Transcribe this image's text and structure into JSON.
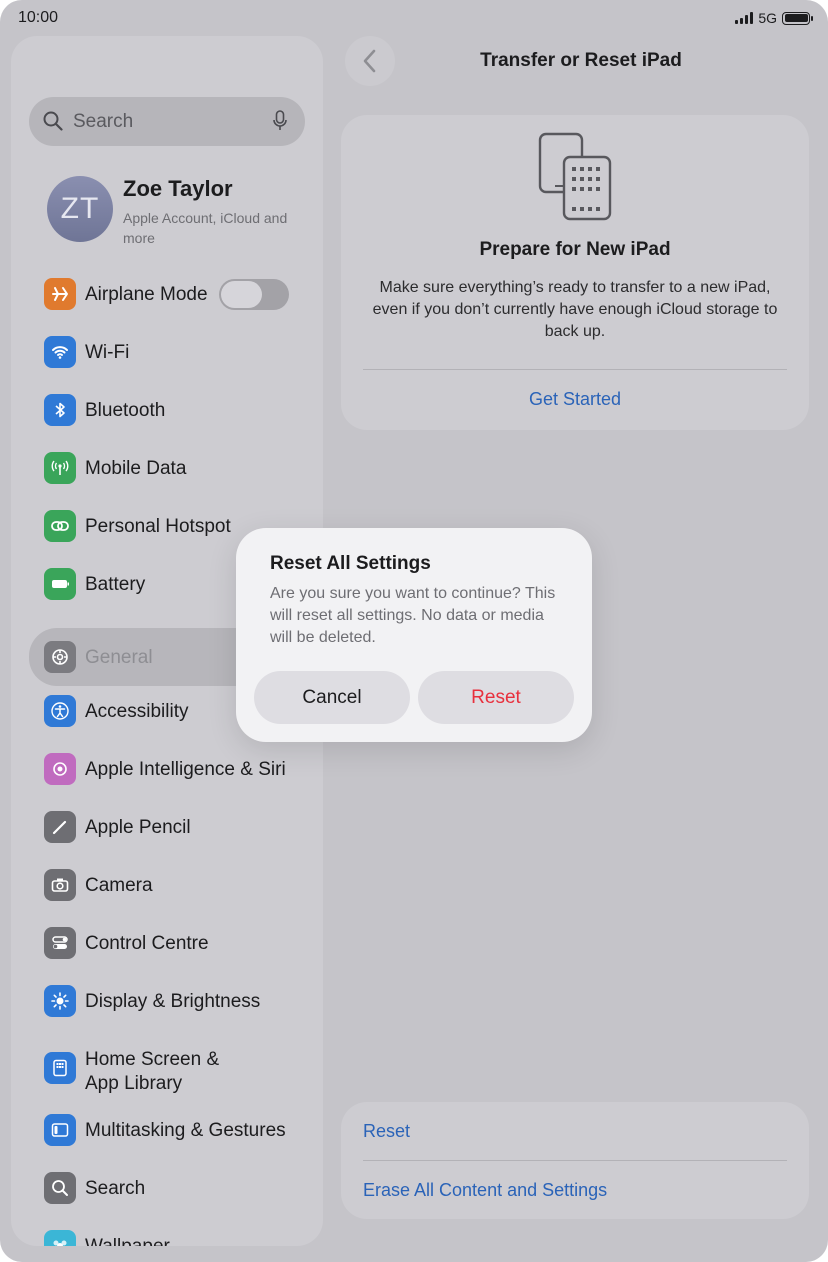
{
  "status": {
    "time": "10:00",
    "network": "5G"
  },
  "sidebar": {
    "search_placeholder": "Search",
    "profile": {
      "initials": "ZT",
      "name": "Zoe Taylor",
      "subtitle": "Apple Account, iCloud and more"
    },
    "items": [
      {
        "label": "Airplane Mode",
        "icon": "airplane-icon",
        "color": "#e07a2e",
        "toggle": false
      },
      {
        "label": "Wi-Fi",
        "icon": "wifi-icon",
        "color": "#2f79d6"
      },
      {
        "label": "Bluetooth",
        "icon": "bluetooth-icon",
        "color": "#2f79d6"
      },
      {
        "label": "Mobile Data",
        "icon": "antenna-icon",
        "color": "#3aa55a"
      },
      {
        "label": "Personal Hotspot",
        "icon": "link-icon",
        "color": "#3aa55a"
      },
      {
        "label": "Battery",
        "icon": "battery-icon",
        "color": "#3aa55a"
      },
      {
        "label": "General",
        "icon": "gear-icon",
        "color": "#7b7b80",
        "selected": true
      },
      {
        "label": "Accessibility",
        "icon": "accessibility-icon",
        "color": "#2f79d6"
      },
      {
        "label": "Apple Intelligence & Siri",
        "icon": "siri-icon",
        "color": "#c06bbf"
      },
      {
        "label": "Apple Pencil",
        "icon": "pencil-icon",
        "color": "#6e6e73"
      },
      {
        "label": "Camera",
        "icon": "camera-icon",
        "color": "#6e6e73"
      },
      {
        "label": "Control Centre",
        "icon": "toggles-icon",
        "color": "#6e6e73"
      },
      {
        "label": "Display & Brightness",
        "icon": "sun-icon",
        "color": "#2f79d6"
      },
      {
        "label": "Home Screen &\nApp Library",
        "icon": "home-grid-icon",
        "color": "#2f79d6"
      },
      {
        "label": "Multitasking & Gestures",
        "icon": "multitask-icon",
        "color": "#2f79d6"
      },
      {
        "label": "Search",
        "icon": "search-icon",
        "color": "#6e6e73"
      },
      {
        "label": "Wallpaper",
        "icon": "wallpaper-icon",
        "color": "#3bb6d6"
      }
    ]
  },
  "detail": {
    "title": "Transfer or Reset iPad",
    "prepare": {
      "heading": "Prepare for New iPad",
      "body": "Make sure everything’s ready to transfer to a new iPad, even if you don’t currently have enough iCloud storage to back up.",
      "link": "Get Started"
    },
    "reset_options": [
      "Reset",
      "Erase All Content and Settings"
    ]
  },
  "alert": {
    "title": "Reset All Settings",
    "message": "Are you sure you want to continue? This will reset all settings. No data or media will be deleted.",
    "cancel": "Cancel",
    "confirm": "Reset"
  },
  "colors": {
    "link": "#2a63b8",
    "destructive": "#e8303d"
  }
}
